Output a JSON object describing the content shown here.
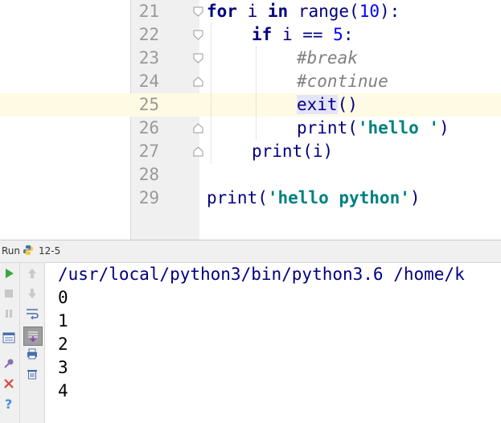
{
  "editor": {
    "lines": [
      {
        "num": "21"
      },
      {
        "num": "22"
      },
      {
        "num": "23"
      },
      {
        "num": "24"
      },
      {
        "num": "25"
      },
      {
        "num": "26"
      },
      {
        "num": "27"
      },
      {
        "num": "28"
      },
      {
        "num": "29"
      }
    ],
    "code": {
      "l21_kw1": "for",
      "l21_var": " i ",
      "l21_kw2": "in",
      "l21_fn": " range(",
      "l21_num": "10",
      "l21_end": "):",
      "l22_kw": "if",
      "l22_mid": " i == ",
      "l22_num": "5",
      "l22_end": ":",
      "l23_comment": "#break",
      "l24_comment": "#continue",
      "l25_call": "exit",
      "l25_end": "()",
      "l26_fn": "print(",
      "l26_str": "'hello '",
      "l26_end": ")",
      "l27_text": "print(i)",
      "l29_fn": "print(",
      "l29_str": "'hello python'",
      "l29_end": ")"
    }
  },
  "run_panel": {
    "label": "Run",
    "config_name": "12-5",
    "output": [
      "/usr/local/python3/bin/python3.6 /home/k",
      "0",
      "1",
      "2",
      "3",
      "4"
    ]
  },
  "colors": {
    "keyword": "#000080",
    "number": "#0000ff",
    "string": "#008080",
    "comment": "#808080",
    "caret_row": "#fffae3"
  }
}
